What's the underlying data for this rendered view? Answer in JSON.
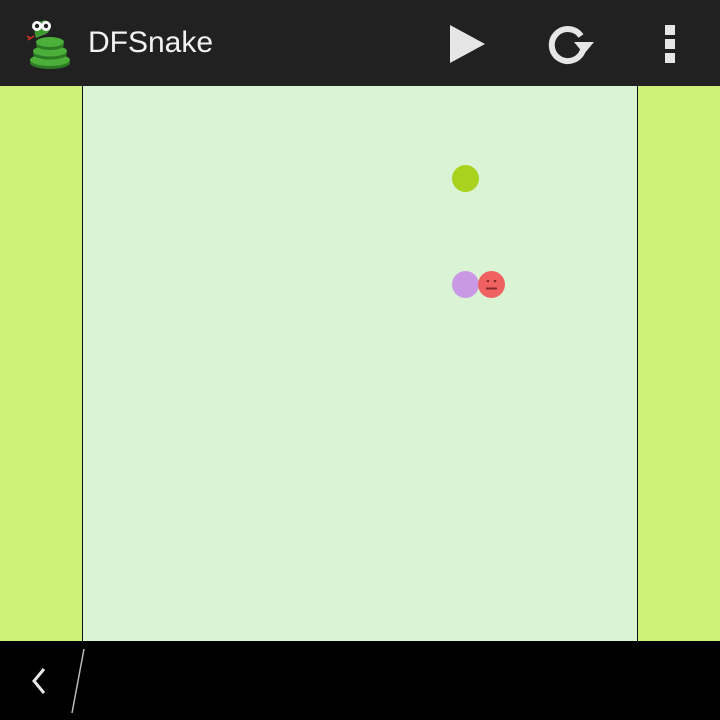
{
  "app": {
    "title": "DFSnake",
    "icon": "snake-logo-icon"
  },
  "toolbar": {
    "play_icon": "play-icon",
    "refresh_icon": "refresh-icon",
    "overflow_icon": "overflow-menu-icon"
  },
  "game": {
    "food_color": "#a8d21e",
    "snake_body_color": "#c999e6",
    "snake_head_color": "#f06262",
    "board_color": "#daf3d4",
    "border_color": "#cef177"
  },
  "navigation": {
    "back_icon": "back-chevron-icon"
  },
  "colors": {
    "action_bar": "#212121",
    "nav_bar": "#000000"
  }
}
